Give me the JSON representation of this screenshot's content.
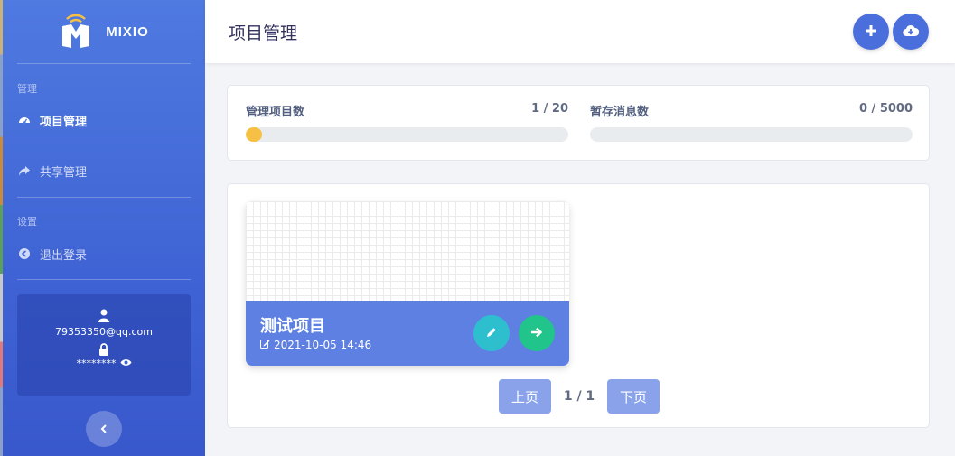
{
  "brand": {
    "name": "MIXIO"
  },
  "sidebar": {
    "section_manage": "管理",
    "nav_projects": "项目管理",
    "nav_share": "共享管理",
    "section_settings": "设置",
    "nav_logout": "退出登录",
    "user": {
      "email": "79353350@qq.com",
      "password_mask": "********"
    }
  },
  "header": {
    "title": "项目管理"
  },
  "stats": {
    "projects": {
      "label": "管理项目数",
      "value": "1 / 20",
      "used": 1,
      "total": 20
    },
    "messages": {
      "label": "暂存消息数",
      "value": "0 / 5000",
      "used": 0,
      "total": 5000
    }
  },
  "projects": [
    {
      "name": "测试项目",
      "time": "2021-10-05 14:46"
    }
  ],
  "pager": {
    "prev_label": "上页",
    "next_label": "下页",
    "info": "1 / 1"
  },
  "colors": {
    "sidebar": "#4f7ae0",
    "accent": "#4a6fdc",
    "card_footer": "#5e80e2",
    "edit": "#2ebfce",
    "go": "#21c48a",
    "progress": "#f5c043"
  }
}
